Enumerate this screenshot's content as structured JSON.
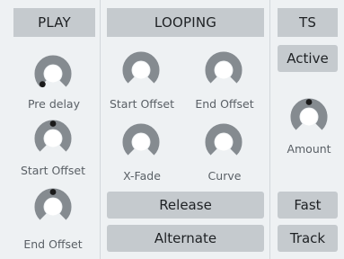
{
  "sections": {
    "play": {
      "title": "PLAY"
    },
    "looping": {
      "title": "LOOPING"
    },
    "ts": {
      "title": "TS"
    }
  },
  "play_knobs": [
    {
      "label": "Pre delay",
      "value": 0.0
    },
    {
      "label": "Start Offset",
      "value": 0.5
    },
    {
      "label": "End Offset",
      "value": 0.5
    }
  ],
  "looping_knobs": [
    {
      "label": "Start Offset"
    },
    {
      "label": "End Offset"
    },
    {
      "label": "X-Fade"
    },
    {
      "label": "Curve"
    }
  ],
  "looping_buttons": {
    "release": "Release",
    "alternate": "Alternate"
  },
  "ts_controls": {
    "active": "Active",
    "amount_label": "Amount",
    "amount_value": 0.5,
    "fast": "Fast",
    "track": "Track"
  },
  "colors": {
    "header_bg": "#c5cace",
    "knob_track": "#b8bdc2",
    "knob_fill": "#7f858b",
    "knob_center": "#ffffff",
    "indicator": "#1a1a1a"
  }
}
